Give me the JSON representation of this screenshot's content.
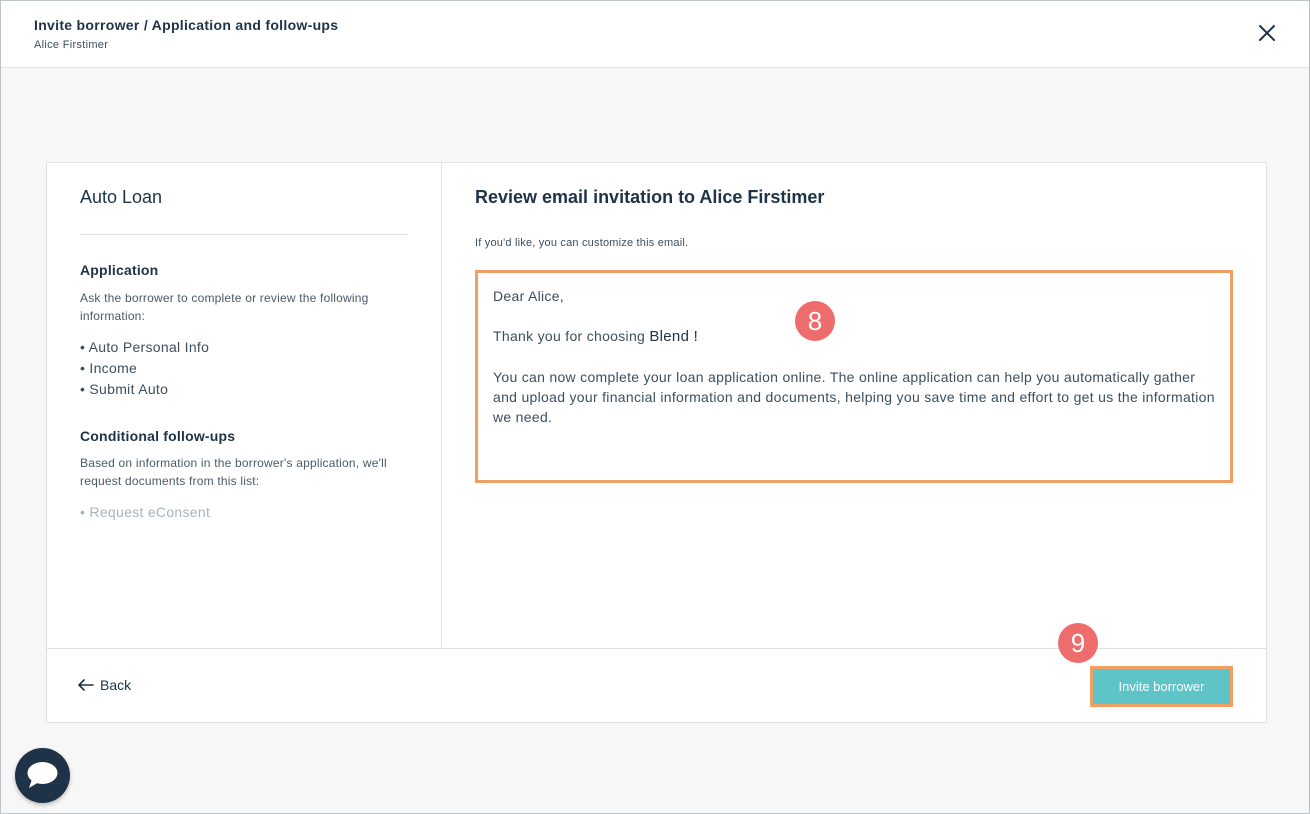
{
  "header": {
    "title": "Invite borrower / Application and follow-ups",
    "subtitle": "Alice Firstimer"
  },
  "left_panel": {
    "loan_title": "Auto Loan",
    "application": {
      "heading": "Application",
      "description": "Ask the borrower to complete or review the following information:",
      "items": [
        "Auto Personal Info",
        "Income",
        "Submit Auto"
      ]
    },
    "followups": {
      "heading": "Conditional follow-ups",
      "description": "Based on information in the borrower's application, we'll request documents from this list:",
      "items": [
        "Request eConsent"
      ]
    }
  },
  "right_panel": {
    "title": "Review email invitation to Alice Firstimer",
    "hint": "If you'd like, you can customize this email.",
    "email": {
      "greeting": "Dear Alice,",
      "thanks_prefix": "Thank you for choosing",
      "brand": "Blend !",
      "body": "You can now complete your loan application online. The online application can help you automatically gather and upload your financial information and documents, helping you save time and effort to get us the information we need."
    }
  },
  "footer": {
    "back_label": "Back",
    "invite_label": "Invite borrower"
  },
  "badges": {
    "email_step": "8",
    "invite_step": "9"
  },
  "colors": {
    "highlight": "#f0a063",
    "badge": "#ee6c6c",
    "primary_button": "#5fc4c8",
    "text_dark": "#1e3347"
  },
  "icons": {
    "close": "close-icon",
    "back": "arrow-left-icon",
    "chat": "chat-icon"
  }
}
